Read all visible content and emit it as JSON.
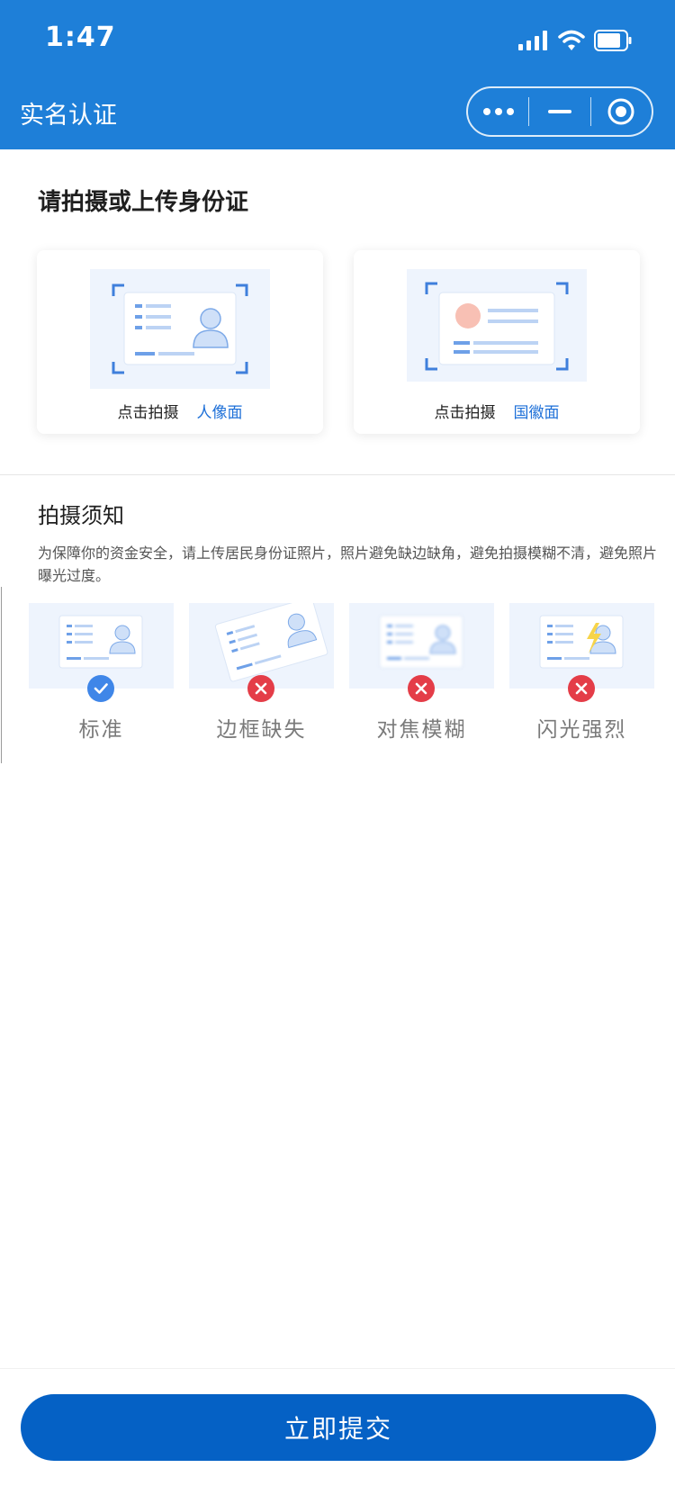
{
  "status_bar": {
    "time": "1:47"
  },
  "nav": {
    "title": "实名认证"
  },
  "upload": {
    "heading": "请拍摄或上传身份证",
    "front": {
      "action": "点击拍摄",
      "side": "人像面"
    },
    "back": {
      "action": "点击拍摄",
      "side": "国徽面"
    }
  },
  "tips": {
    "heading": "拍摄须知",
    "text": "为保障你的资金安全，请上传居民身份证照片，照片避免缺边缺角，避免拍摄模糊不清，避免照片曝光过度。",
    "examples": [
      {
        "label": "标准",
        "status": "ok"
      },
      {
        "label": "边框缺失",
        "status": "bad"
      },
      {
        "label": "对焦模糊",
        "status": "bad"
      },
      {
        "label": "闪光强烈",
        "status": "bad"
      }
    ]
  },
  "footer": {
    "submit_label": "立即提交"
  },
  "colors": {
    "header": "#1e7fd8",
    "accent": "#1e70d8",
    "submit": "#0561c5",
    "ok": "#3f86e8",
    "error": "#e43d48"
  }
}
